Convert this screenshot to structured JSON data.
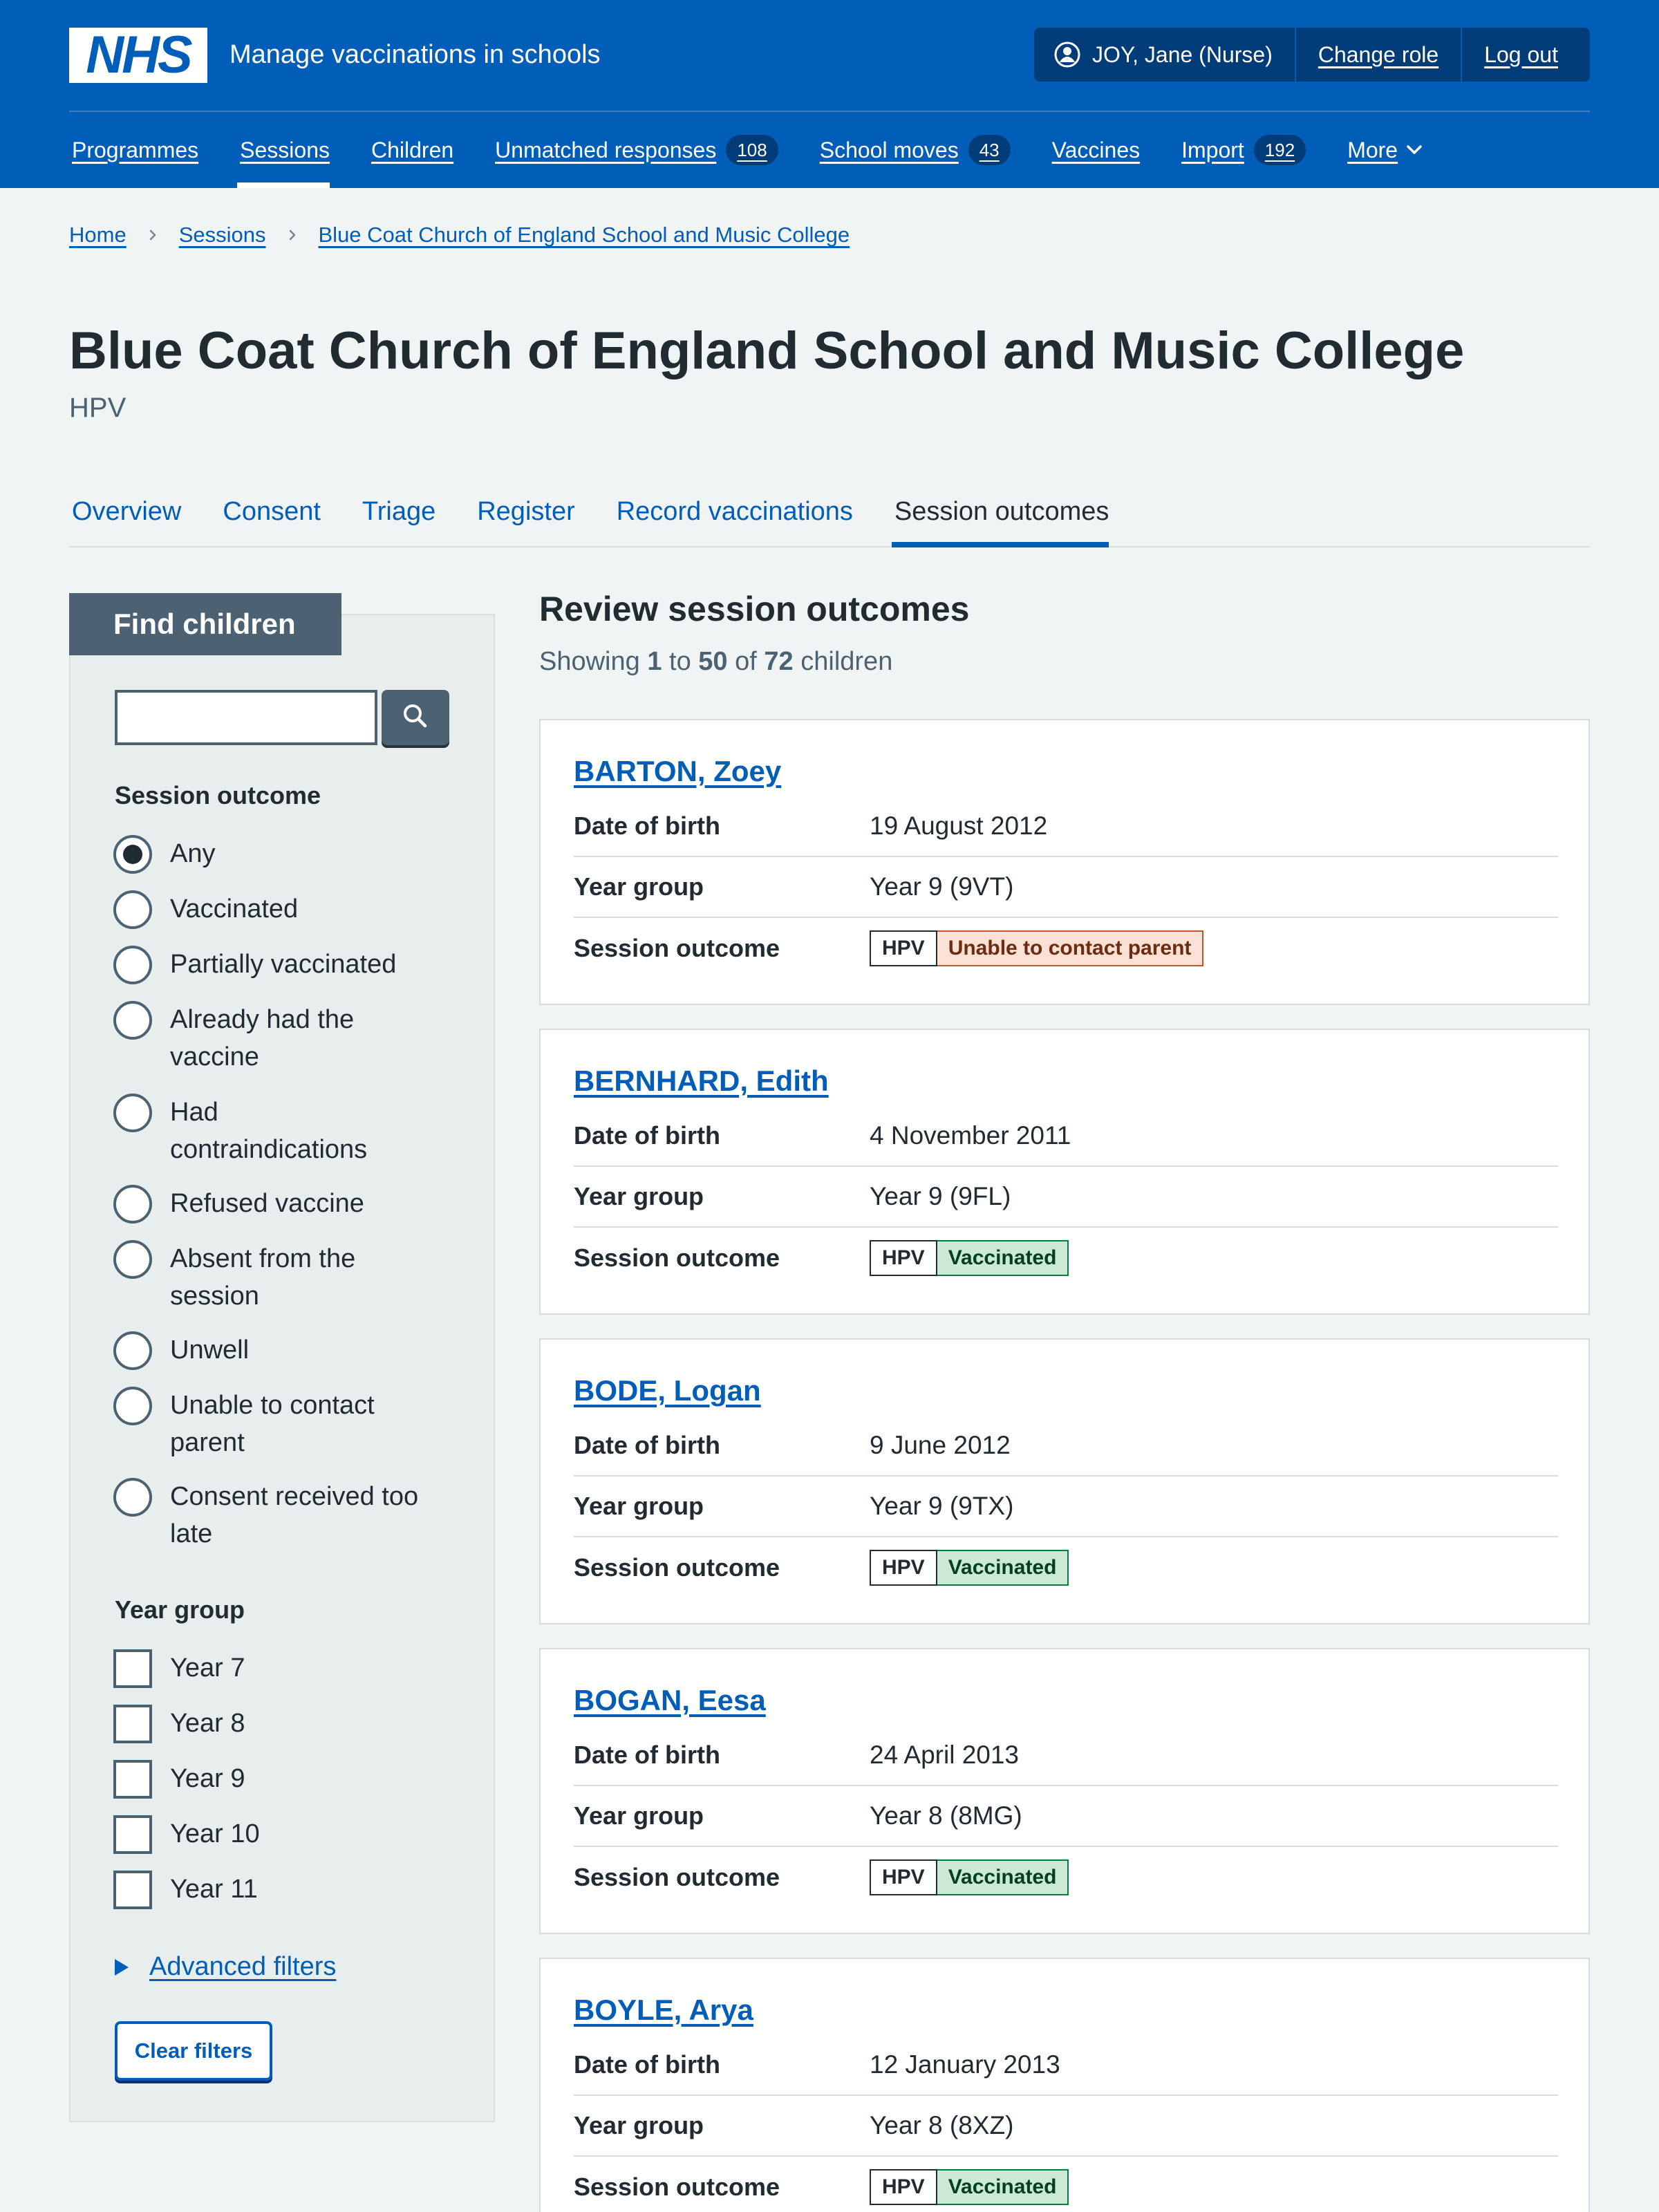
{
  "header": {
    "logo_text": "NHS",
    "service_name": "Manage vaccinations in schools",
    "user": "JOY, Jane (Nurse)",
    "change_role": "Change role",
    "log_out": "Log out"
  },
  "nav": [
    {
      "label": "Programmes"
    },
    {
      "label": "Sessions",
      "active": true
    },
    {
      "label": "Children"
    },
    {
      "label": "Unmatched responses",
      "count": "108"
    },
    {
      "label": "School moves",
      "count": "43"
    },
    {
      "label": "Vaccines"
    },
    {
      "label": "Import",
      "count": "192"
    },
    {
      "label": "More"
    }
  ],
  "breadcrumb": [
    "Home",
    "Sessions",
    "Blue Coat Church of England School and Music College"
  ],
  "page": {
    "title": "Blue Coat Church of England School and Music College",
    "caption": "HPV"
  },
  "tabs": [
    "Overview",
    "Consent",
    "Triage",
    "Register",
    "Record vaccinations",
    "Session outcomes"
  ],
  "filters": {
    "heading": "Find children",
    "search_value": "",
    "session_outcome_legend": "Session outcome",
    "session_outcomes": [
      "Any",
      "Vaccinated",
      "Partially vaccinated",
      "Already had the vaccine",
      "Had contraindications",
      "Refused vaccine",
      "Absent from the session",
      "Unwell",
      "Unable to contact parent",
      "Consent received too late"
    ],
    "selected_outcome": "Any",
    "year_group_legend": "Year group",
    "year_groups": [
      "Year 7",
      "Year 8",
      "Year 9",
      "Year 10",
      "Year 11"
    ],
    "advanced": "Advanced filters",
    "clear": "Clear filters"
  },
  "results": {
    "heading": "Review session outcomes",
    "count_prefix": "Showing",
    "from": "1",
    "to_word": "to",
    "to": "50",
    "of_word": "of",
    "total": "72",
    "count_suffix": "children",
    "labels": {
      "dob": "Date of birth",
      "year": "Year group",
      "outcome": "Session outcome"
    },
    "children": [
      {
        "name": "BARTON, Zoey",
        "dob": "19 August 2012",
        "year": "Year 9 (9VT)",
        "programme": "HPV",
        "outcome": "Unable to contact parent",
        "status_color": "#fbe1d5"
      },
      {
        "name": "BERNHARD, Edith",
        "dob": "4 November 2011",
        "year": "Year 9 (9FL)",
        "programme": "HPV",
        "outcome": "Vaccinated",
        "status_color": "#cce8d7"
      },
      {
        "name": "BODE, Logan",
        "dob": "9 June 2012",
        "year": "Year 9 (9TX)",
        "programme": "HPV",
        "outcome": "Vaccinated",
        "status_color": "#cce8d7"
      },
      {
        "name": "BOGAN, Eesa",
        "dob": "24 April 2013",
        "year": "Year 8 (8MG)",
        "programme": "HPV",
        "outcome": "Vaccinated",
        "status_color": "#cce8d7"
      },
      {
        "name": "BOYLE, Arya",
        "dob": "12 January 2013",
        "year": "Year 8 (8XZ)",
        "programme": "HPV",
        "outcome": "Vaccinated",
        "status_color": "#cce8d7"
      }
    ]
  },
  "colors": {
    "nhs_blue": "#005eb8",
    "dark_blue": "#003d78",
    "text": "#212b32",
    "secondary_text": "#4c6272",
    "page_bg": "#f0f4f5"
  }
}
